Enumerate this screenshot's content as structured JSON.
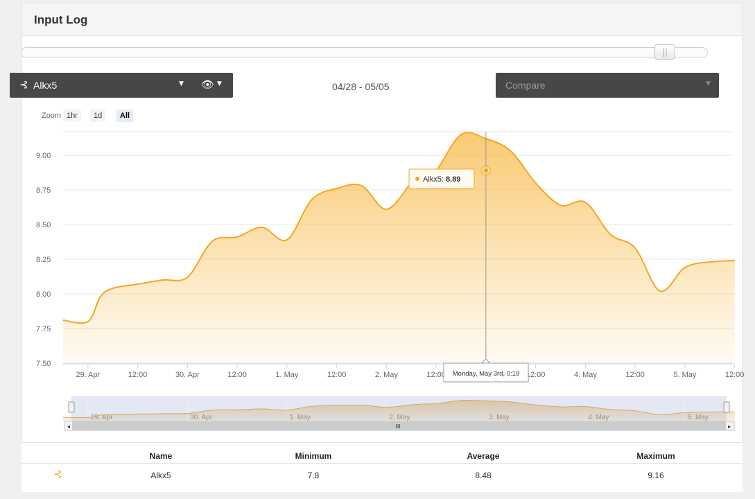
{
  "panel": {
    "title": "Input Log"
  },
  "selector": {
    "icon": "probe-icon",
    "glyph": "⊰",
    "label": "Alkx5",
    "caret": "▼",
    "eye_glyph": "👁",
    "eye_caret": "▼"
  },
  "date_range": "04/28 - 05/05",
  "compare": {
    "label": "Compare",
    "caret": "▼"
  },
  "zoom": {
    "label": "Zoom",
    "buttons": [
      "1hr",
      "1d",
      "All"
    ],
    "active": "All"
  },
  "colors": {
    "accent": "#f5a623",
    "dark_bar": "#474747",
    "navigator_fill": "#ccd6eb"
  },
  "chart_data": {
    "type": "area",
    "x_labels": [
      "29. Apr",
      "12:00",
      "30. Apr",
      "12:00",
      "1. May",
      "12:00",
      "2. May",
      "12:00",
      "3. May",
      "12:00",
      "4. May",
      "12:00",
      "5. May",
      "12:00"
    ],
    "y_ticks": [
      "7.50",
      "7.75",
      "8.00",
      "8.25",
      "8.50",
      "8.75",
      "9.00"
    ],
    "ylim": [
      7.5,
      9.17
    ],
    "x_range": [
      "28. Apr",
      "5. May 12:00"
    ],
    "series": [
      {
        "name": "Alkx5",
        "x": [
          "28. Apr 18:00",
          "29. Apr 00:00",
          "29. Apr 03:00",
          "29. Apr 06:00",
          "29. Apr 12:00",
          "29. Apr 18:00",
          "30. Apr 00:00",
          "30. Apr 06:00",
          "30. Apr 12:00",
          "30. Apr 18:00",
          "1. May 00:00",
          "1. May 06:00",
          "1. May 12:00",
          "1. May 18:00",
          "2. May 00:00",
          "2. May 06:00",
          "2. May 09:00",
          "2. May 12:00",
          "2. May 18:00",
          "3. May 00:00",
          "3. May 06:00",
          "3. May 12:00",
          "3. May 18:00",
          "4. May 00:00",
          "4. May 06:00",
          "4. May 12:00",
          "4. May 18:00",
          "5. May 00:00",
          "5. May 06:00",
          "5. May 12:00"
        ],
        "values": [
          7.81,
          7.8,
          7.98,
          8.04,
          8.07,
          8.1,
          8.12,
          8.38,
          8.41,
          8.48,
          8.39,
          8.68,
          8.76,
          8.78,
          8.61,
          8.8,
          8.87,
          8.89,
          9.15,
          9.12,
          9.03,
          8.8,
          8.64,
          8.66,
          8.43,
          8.33,
          8.02,
          8.19,
          8.23,
          8.24
        ]
      }
    ],
    "tooltip": {
      "series": "Alkx5",
      "value": "8.89",
      "time": "Monday, May 3rd, 0:19"
    },
    "navigator_labels": [
      "29. Apr",
      "30. Apr",
      "1. May",
      "2. May",
      "3. May",
      "4. May",
      "5. May"
    ],
    "grid": true,
    "legend": "none"
  },
  "stats": {
    "headers": [
      "Name",
      "Minimum",
      "Average",
      "Maximum"
    ],
    "rows": [
      {
        "icon": "probe-icon",
        "glyph": "⊰",
        "name": "Alkx5",
        "min": "7.8",
        "avg": "8.48",
        "max": "9.16"
      }
    ]
  }
}
